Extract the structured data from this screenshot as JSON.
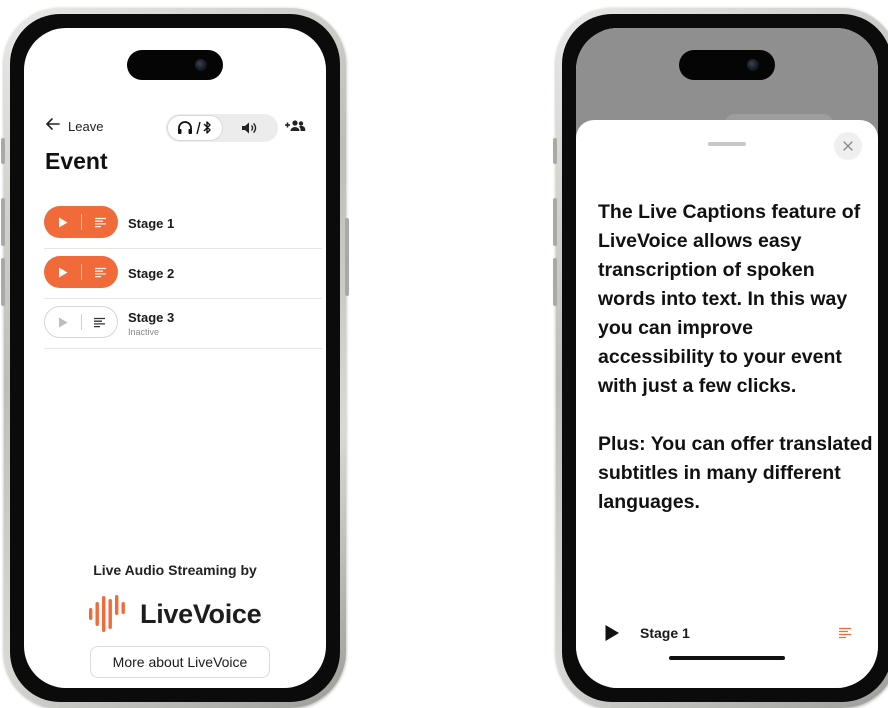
{
  "left_phone": {
    "header": {
      "leave_label": "Leave",
      "toggle": {
        "active": "headphones-bluetooth",
        "inactive": "speaker"
      }
    },
    "title": "Event",
    "stages": [
      {
        "name": "Stage 1",
        "status": "active",
        "subtitle": ""
      },
      {
        "name": "Stage 2",
        "status": "active",
        "subtitle": ""
      },
      {
        "name": "Stage 3",
        "status": "inactive",
        "subtitle": "Inactive"
      }
    ],
    "footer": {
      "powered_by": "Live Audio Streaming by",
      "brand_name": "LiveVoice",
      "more_button": "More about LiveVoice"
    }
  },
  "right_phone": {
    "sheet": {
      "paragraph_1": "The Live Captions feature of LiveVoice allows easy transcription of spoken words into text. In this way you can improve accessibility to your event with just a few clicks.",
      "paragraph_2": "Plus: You can offer translated subtitles in many different languages.",
      "close_icon": "close-icon"
    },
    "player": {
      "stage_name": "Stage 1"
    }
  },
  "colors": {
    "accent": "#f06a3a",
    "text": "#111111",
    "divider": "#e6e6e6",
    "backdrop": "#8f8f8f"
  }
}
